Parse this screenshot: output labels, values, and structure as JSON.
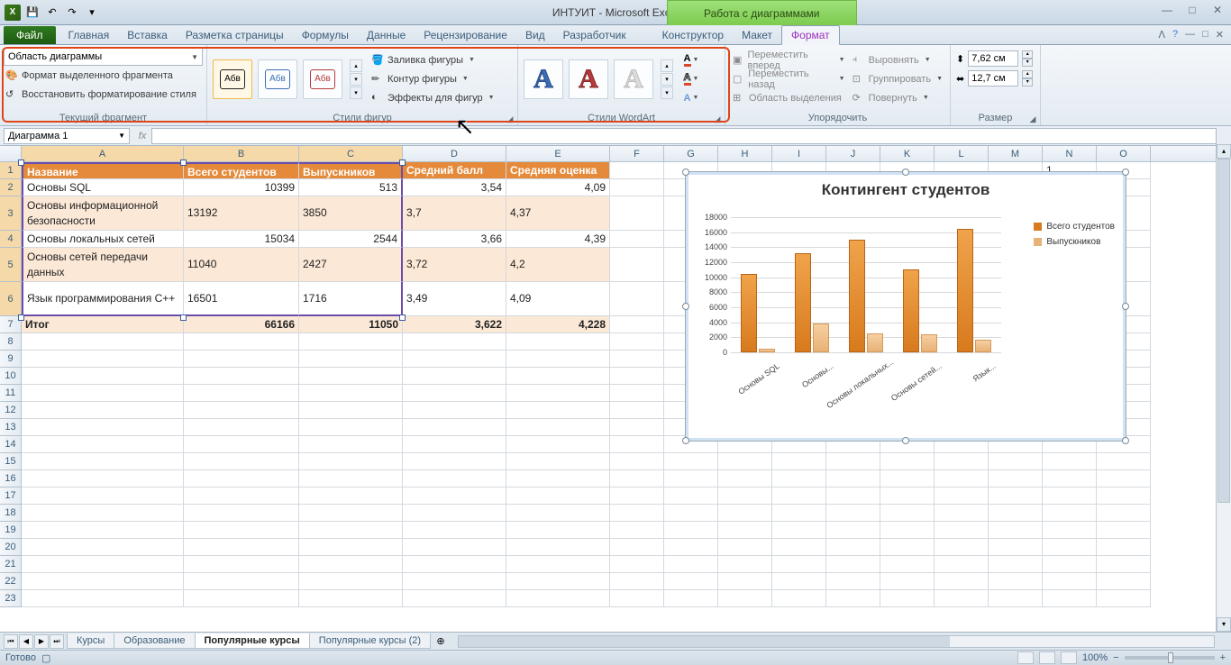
{
  "title": "ИНТУИТ - Microsoft Excel",
  "chart_tools_label": "Работа с диаграммами",
  "tabs": {
    "file": "Файл",
    "items": [
      "Главная",
      "Вставка",
      "Разметка страницы",
      "Формулы",
      "Данные",
      "Рецензирование",
      "Вид",
      "Разработчик",
      "Конструктор",
      "Макет",
      "Формат"
    ],
    "active_index": 10
  },
  "ribbon": {
    "current_fragment": {
      "selector_value": "Область диаграммы",
      "format_selection": "Формат выделенного фрагмента",
      "reset_style": "Восстановить форматирование стиля",
      "group_label": "Текущий фрагмент"
    },
    "shape_styles": {
      "swatch_text": "Абв",
      "fill": "Заливка фигуры",
      "outline": "Контур фигуры",
      "effects": "Эффекты для фигур",
      "group_label": "Стили фигур"
    },
    "wordart": {
      "group_label": "Стили WordArt"
    },
    "arrange": {
      "bring_forward": "Переместить вперед",
      "send_backward": "Переместить назад",
      "selection_pane": "Область выделения",
      "align": "Выровнять",
      "group": "Группировать",
      "rotate": "Повернуть",
      "group_label": "Упорядочить"
    },
    "size": {
      "height": "7,62 см",
      "width": "12,7 см",
      "group_label": "Размер"
    }
  },
  "name_box": "Диаграмма 1",
  "columns": [
    "A",
    "B",
    "C",
    "D",
    "E",
    "F",
    "G",
    "H",
    "I",
    "J",
    "K",
    "L",
    "M",
    "N",
    "O"
  ],
  "headers": [
    "Название",
    "Всего студентов",
    "Выпускников",
    "Средний балл",
    "Средняя оценка"
  ],
  "rows": [
    {
      "n": "1",
      "a": "Название",
      "b": "Всего студентов",
      "c": "Выпускников",
      "d": "Средний балл",
      "e": "Средняя оценка",
      "hdr": true
    },
    {
      "n": "2",
      "a": "Основы SQL",
      "b": "10399",
      "c": "513",
      "d": "3,54",
      "e": "4,09"
    },
    {
      "n": "3",
      "a": "Основы информационной безопасности",
      "b": "13192",
      "c": "3850",
      "d": "3,7",
      "e": "4,37",
      "tall": true,
      "band": true
    },
    {
      "n": "4",
      "a": "Основы локальных сетей",
      "b": "15034",
      "c": "2544",
      "d": "3,66",
      "e": "4,39"
    },
    {
      "n": "5",
      "a": "Основы сетей передачи данных",
      "b": "11040",
      "c": "2427",
      "d": "3,72",
      "e": "4,2",
      "tall": true,
      "band": true
    },
    {
      "n": "6",
      "a": "Язык программирования С++",
      "b": "16501",
      "c": "1716",
      "d": "3,49",
      "e": "4,09",
      "tall": true
    },
    {
      "n": "7",
      "a": "Итог",
      "b": "66166",
      "c": "11050",
      "d": "3,622",
      "e": "4,228",
      "bold": true,
      "band": true
    }
  ],
  "empty_rows": [
    "8",
    "9",
    "10",
    "11",
    "12",
    "13",
    "14",
    "15",
    "16",
    "17",
    "18",
    "19",
    "20",
    "21",
    "22",
    "23"
  ],
  "sheets": {
    "items": [
      "Курсы",
      "Образование",
      "Популярные курсы",
      "Популярные курсы (2)"
    ],
    "active_index": 2
  },
  "status": {
    "ready": "Готово",
    "zoom": "100%"
  },
  "chart_data": {
    "type": "bar",
    "title": "Контингент студентов",
    "categories": [
      "Основы SQL",
      "Основы информационной безопасности",
      "Основы локальных сетей",
      "Основы сетей передачи данных",
      "Язык программирования С++"
    ],
    "categories_short": [
      "Основы SQL",
      "Основы...",
      "Основы локальных...",
      "Основы сетей...",
      "Язык..."
    ],
    "series": [
      {
        "name": "Всего студентов",
        "values": [
          10399,
          13192,
          15034,
          11040,
          16501
        ],
        "color": "#d87a1e"
      },
      {
        "name": "Выпускников",
        "values": [
          513,
          3850,
          2544,
          2427,
          1716
        ],
        "color": "#e8b277"
      }
    ],
    "ylim": [
      0,
      18000
    ],
    "yticks": [
      0,
      2000,
      4000,
      6000,
      8000,
      10000,
      12000,
      14000,
      16000,
      18000
    ]
  }
}
